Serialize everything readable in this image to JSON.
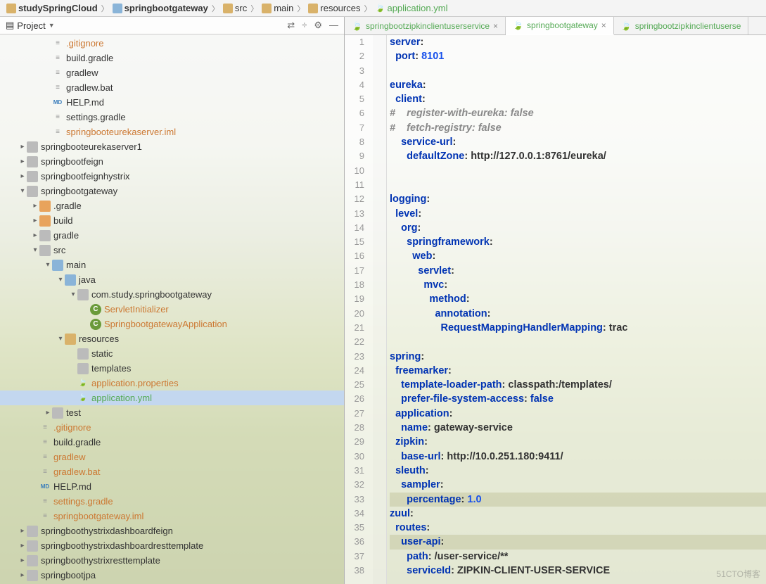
{
  "breadcrumb": [
    {
      "icon": "folder",
      "label": "studySpringCloud",
      "bold": true
    },
    {
      "icon": "module",
      "label": "springbootgateway",
      "bold": true
    },
    {
      "icon": "folder",
      "label": "src"
    },
    {
      "icon": "folder",
      "label": "main"
    },
    {
      "icon": "folder",
      "label": "resources"
    },
    {
      "icon": "leaf",
      "label": "application.yml",
      "green": true
    }
  ],
  "panel": {
    "title": "Project",
    "tools": [
      "⇄",
      "÷",
      "⚙",
      "—"
    ]
  },
  "tree": [
    {
      "indent": 3,
      "arrow": "",
      "icon": "file-gray",
      "label": ".gitignore",
      "cls": "file-orange"
    },
    {
      "indent": 3,
      "arrow": "",
      "icon": "file-gray",
      "label": "build.gradle"
    },
    {
      "indent": 3,
      "arrow": "",
      "icon": "file-gray",
      "label": "gradlew"
    },
    {
      "indent": 3,
      "arrow": "",
      "icon": "file-gray",
      "label": "gradlew.bat"
    },
    {
      "indent": 3,
      "arrow": "",
      "icon": "file-md",
      "label": "HELP.md"
    },
    {
      "indent": 3,
      "arrow": "",
      "icon": "file-gray",
      "label": "settings.gradle"
    },
    {
      "indent": 3,
      "arrow": "",
      "icon": "file-gray",
      "label": "springbooteurekaserver.iml",
      "cls": "file-orange"
    },
    {
      "indent": 1,
      "arrow": "▸",
      "icon": "folder gray",
      "label": "springbooteurekaserver1"
    },
    {
      "indent": 1,
      "arrow": "▸",
      "icon": "folder gray",
      "label": "springbootfeign"
    },
    {
      "indent": 1,
      "arrow": "▸",
      "icon": "folder gray",
      "label": "springbootfeignhystrix"
    },
    {
      "indent": 1,
      "arrow": "▾",
      "icon": "folder gray",
      "label": "springbootgateway"
    },
    {
      "indent": 2,
      "arrow": "▸",
      "icon": "folder orange",
      "label": ".gradle"
    },
    {
      "indent": 2,
      "arrow": "▸",
      "icon": "folder orange",
      "label": "build"
    },
    {
      "indent": 2,
      "arrow": "▸",
      "icon": "folder gray",
      "label": "gradle"
    },
    {
      "indent": 2,
      "arrow": "▾",
      "icon": "folder gray",
      "label": "src"
    },
    {
      "indent": 3,
      "arrow": "▾",
      "icon": "folder blue",
      "label": "main"
    },
    {
      "indent": 4,
      "arrow": "▾",
      "icon": "folder blue",
      "label": "java"
    },
    {
      "indent": 5,
      "arrow": "▾",
      "icon": "folder gray",
      "label": "com.study.springbootgateway"
    },
    {
      "indent": 6,
      "arrow": "",
      "icon": "class",
      "label": "ServletInitializer",
      "cls": "file-orange"
    },
    {
      "indent": 6,
      "arrow": "",
      "icon": "class",
      "label": "SpringbootgatewayApplication",
      "cls": "file-orange"
    },
    {
      "indent": 4,
      "arrow": "▾",
      "icon": "folder",
      "label": "resources"
    },
    {
      "indent": 5,
      "arrow": "",
      "icon": "folder gray",
      "label": "static"
    },
    {
      "indent": 5,
      "arrow": "",
      "icon": "folder gray",
      "label": "templates"
    },
    {
      "indent": 5,
      "arrow": "",
      "icon": "leaf",
      "label": "application.properties",
      "cls": "file-orange"
    },
    {
      "indent": 5,
      "arrow": "",
      "icon": "leaf",
      "label": "application.yml",
      "cls": "file-green",
      "selected": true
    },
    {
      "indent": 3,
      "arrow": "▸",
      "icon": "folder gray",
      "label": "test"
    },
    {
      "indent": 2,
      "arrow": "",
      "icon": "file-gray",
      "label": ".gitignore",
      "cls": "file-orange"
    },
    {
      "indent": 2,
      "arrow": "",
      "icon": "file-gray",
      "label": "build.gradle"
    },
    {
      "indent": 2,
      "arrow": "",
      "icon": "file-gray",
      "label": "gradlew",
      "cls": "file-orange"
    },
    {
      "indent": 2,
      "arrow": "",
      "icon": "file-gray",
      "label": "gradlew.bat",
      "cls": "file-orange"
    },
    {
      "indent": 2,
      "arrow": "",
      "icon": "file-md",
      "label": "HELP.md"
    },
    {
      "indent": 2,
      "arrow": "",
      "icon": "file-gray",
      "label": "settings.gradle",
      "cls": "file-orange"
    },
    {
      "indent": 2,
      "arrow": "",
      "icon": "file-gray",
      "label": "springbootgateway.iml",
      "cls": "file-orange"
    },
    {
      "indent": 1,
      "arrow": "▸",
      "icon": "folder gray",
      "label": "springboothystrixdashboardfeign"
    },
    {
      "indent": 1,
      "arrow": "▸",
      "icon": "folder gray",
      "label": "springboothystrixdashboardresttemplate"
    },
    {
      "indent": 1,
      "arrow": "▸",
      "icon": "folder gray",
      "label": "springboothystrixresttemplate"
    },
    {
      "indent": 1,
      "arrow": "▸",
      "icon": "folder gray",
      "label": "springbootjpa"
    }
  ],
  "tabs": [
    {
      "label": "springbootzipkinclientuserservice",
      "active": false
    },
    {
      "label": "springbootgateway",
      "active": true
    },
    {
      "label": "springbootzipkinclientuserse",
      "active": false,
      "noclose": true
    }
  ],
  "code": [
    {
      "n": 1,
      "html": "<span class='k-key'>server</span>:"
    },
    {
      "n": 2,
      "html": "  <span class='k-key'>port</span>: <span class='k-num'>8101</span>"
    },
    {
      "n": 3,
      "html": ""
    },
    {
      "n": 4,
      "html": "<span class='k-key'>eureka</span>:"
    },
    {
      "n": 5,
      "html": "  <span class='k-key'>client</span>:"
    },
    {
      "n": 6,
      "html": "<span class='k-cmt'>#    register-with-eureka: false</span>"
    },
    {
      "n": 7,
      "html": "<span class='k-cmt'>#    fetch-registry: false</span>"
    },
    {
      "n": 8,
      "html": "    <span class='k-key'>service-url</span>:"
    },
    {
      "n": 9,
      "html": "      <span class='k-key'>defaultZone</span>: http://127.0.0.1:8761/eureka/"
    },
    {
      "n": 10,
      "html": ""
    },
    {
      "n": 11,
      "html": ""
    },
    {
      "n": 12,
      "html": "<span class='k-key'>logging</span>:"
    },
    {
      "n": 13,
      "html": "  <span class='k-key'>level</span>:"
    },
    {
      "n": 14,
      "html": "    <span class='k-key'>org</span>:"
    },
    {
      "n": 15,
      "html": "      <span class='k-key'>springframework</span>:"
    },
    {
      "n": 16,
      "html": "        <span class='k-key'>web</span>:"
    },
    {
      "n": 17,
      "html": "          <span class='k-key'>servlet</span>:"
    },
    {
      "n": 18,
      "html": "            <span class='k-key'>mvc</span>:"
    },
    {
      "n": 19,
      "html": "              <span class='k-key'>method</span>:"
    },
    {
      "n": 20,
      "html": "                <span class='k-key'>annotation</span>:"
    },
    {
      "n": 21,
      "html": "                  <span class='k-key'>RequestMappingHandlerMapping</span>: trac"
    },
    {
      "n": 22,
      "html": ""
    },
    {
      "n": 23,
      "html": "<span class='k-key'>spring</span>:"
    },
    {
      "n": 24,
      "html": "  <span class='k-key'>freemarker</span>:"
    },
    {
      "n": 25,
      "html": "    <span class='k-key'>template-loader-path</span>: classpath:/templates/"
    },
    {
      "n": 26,
      "html": "    <span class='k-key'>prefer-file-system-access</span>: <span class='k-key'>false</span>"
    },
    {
      "n": 27,
      "html": "  <span class='k-key'>application</span>:"
    },
    {
      "n": 28,
      "html": "    <span class='k-key'>name</span>: gateway-service"
    },
    {
      "n": 29,
      "html": "  <span class='k-key'>zipkin</span>:"
    },
    {
      "n": 30,
      "html": "    <span class='k-key'>base-url</span>: http://10.0.251.180:9411/"
    },
    {
      "n": 31,
      "html": "  <span class='k-key'>sleuth</span>:"
    },
    {
      "n": 32,
      "html": "    <span class='k-key'>sampler</span>:"
    },
    {
      "n": 33,
      "html": "      <span class='k-key'>percentage</span>: <span class='k-num'>1.0</span>",
      "hl": true
    },
    {
      "n": 34,
      "html": "<span class='k-key'>zuul</span>:"
    },
    {
      "n": 35,
      "html": "  <span class='k-key'>routes</span>:"
    },
    {
      "n": 36,
      "html": "    <span class='k-key'>user-api</span>:",
      "hl": true
    },
    {
      "n": 37,
      "html": "      <span class='k-key'>path</span>: /user-service/**"
    },
    {
      "n": 38,
      "html": "      <span class='k-key'>serviceId</span>: ZIPKIN-CLIENT-USER-SERVICE"
    }
  ],
  "watermark": "51CTO博客"
}
